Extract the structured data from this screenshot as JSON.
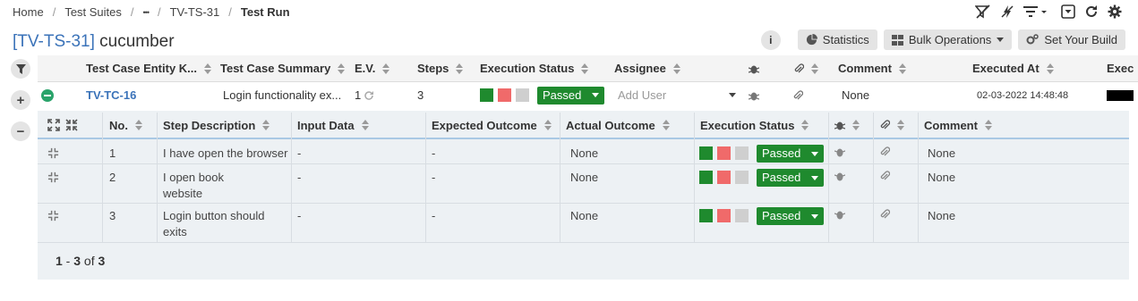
{
  "breadcrumb": {
    "home": "Home",
    "suites": "Test Suites",
    "ellipsis": "•••",
    "parent": "TV-TS-31",
    "current": "Test Run"
  },
  "title": {
    "key": "[TV-TS-31]",
    "name": "cucumber"
  },
  "actions": {
    "info": "i",
    "statistics": "Statistics",
    "bulk": "Bulk Operations",
    "build": "Set Your Build"
  },
  "gutter": {
    "plus": "+",
    "minus": "−"
  },
  "main_table": {
    "headers": {
      "key": "Test Case Entity K...",
      "summary": "Test Case Summary",
      "ev": "E.V.",
      "steps": "Steps",
      "exec_status": "Execution Status",
      "assignee": "Assignee",
      "comment": "Comment",
      "executed_at": "Executed At",
      "exec": "Exec"
    },
    "row": {
      "key": "TV-TC-16",
      "summary": "Login functionality ex...",
      "ev": "1",
      "steps": "3",
      "status": "Passed",
      "assignee_placeholder": "Add User",
      "comment": "None",
      "executed_at": "02-03-2022 14:48:48"
    }
  },
  "step_table": {
    "headers": {
      "no": "No.",
      "description": "Step Description",
      "input": "Input Data",
      "expected": "Expected Outcome",
      "actual": "Actual Outcome",
      "status": "Execution Status",
      "comment": "Comment"
    },
    "rows": [
      {
        "no": "1",
        "description_l1": "I have open the browser",
        "description_l2": "",
        "input": "-",
        "expected": "-",
        "actual": "None",
        "status": "Passed",
        "comment": "None"
      },
      {
        "no": "2",
        "description_l1": "I open book",
        "description_l2": "website",
        "input": "-",
        "expected": "-",
        "actual": "None",
        "status": "Passed",
        "comment": "None"
      },
      {
        "no": "3",
        "description_l1": "Login button should",
        "description_l2": "exits",
        "input": "-",
        "expected": "-",
        "actual": "None",
        "status": "Passed",
        "comment": "None"
      }
    ],
    "pager": {
      "from": "1",
      "dash": " - ",
      "to": "3",
      "of": " of ",
      "total": "3"
    }
  },
  "colors": {
    "pass": "#1f8a2e",
    "fail": "#f06a6a",
    "not_run": "#cfcfcf",
    "link": "#3b73b9"
  }
}
